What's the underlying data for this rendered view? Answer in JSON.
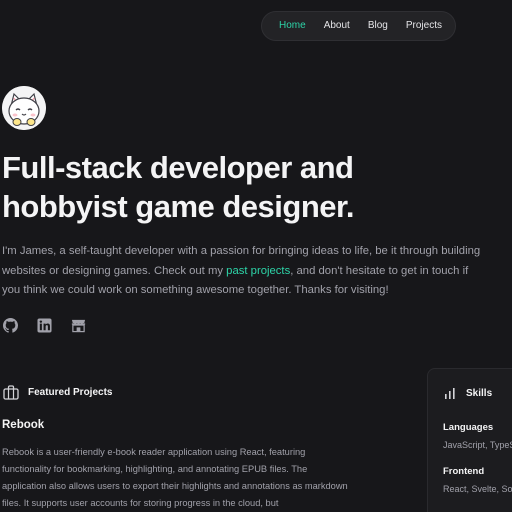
{
  "nav": {
    "items": [
      {
        "label": "Home",
        "active": true
      },
      {
        "label": "About"
      },
      {
        "label": "Blog"
      },
      {
        "label": "Projects"
      }
    ],
    "accent_color": "#2dd4a8"
  },
  "hero": {
    "avatar_icon": "cat-avatar-icon",
    "headline_line1": "Full-stack developer and",
    "headline_line2": "hobbyist game designer.",
    "intro_before_link": "I'm James, a self-taught developer with a passion for bringing ideas to life, be it through building websites or designing games. Check out my ",
    "intro_link": "past projects",
    "intro_after_link": ", and don't hesitate to get in touch if you think we could work on something awesome together. Thanks for visiting!"
  },
  "socials": [
    {
      "icon": "github-icon"
    },
    {
      "icon": "linkedin-icon"
    },
    {
      "icon": "storefront-icon"
    }
  ],
  "featured": {
    "icon": "briefcase-icon",
    "label": "Featured Projects",
    "project_title": "Rebook",
    "project_desc": "Rebook is a user-friendly e-book reader application using React, featuring functionality for bookmarking, highlighting, and annotating EPUB files. The application also allows users to export their highlights and annotations as markdown files. It supports user accounts for storing progress in the cloud, but"
  },
  "skills": {
    "icon": "bar-chart-icon",
    "title": "Skills",
    "categories": [
      {
        "name": "Languages",
        "items": "JavaScript, TypeScript"
      },
      {
        "name": "Frontend",
        "items": "React, Svelte, Solid"
      }
    ]
  }
}
